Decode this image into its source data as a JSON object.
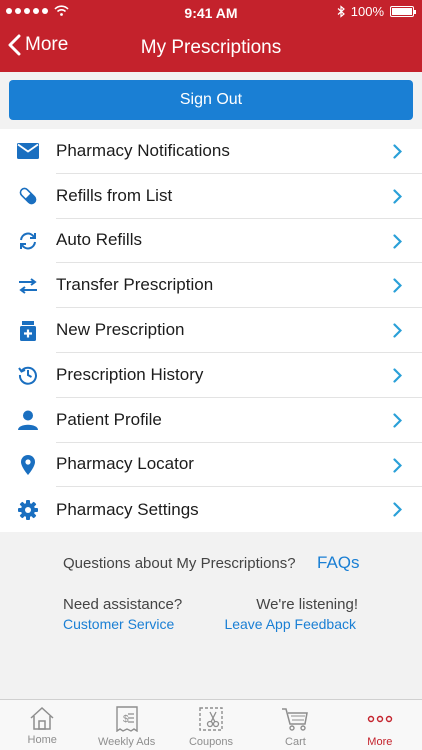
{
  "status_bar": {
    "time": "9:41 AM",
    "battery": "100%",
    "battery_level": 1.0
  },
  "nav": {
    "back_label": "More",
    "title": "My Prescriptions"
  },
  "sign_out": {
    "label": "Sign Out"
  },
  "menu": {
    "items": [
      {
        "label": "Pharmacy Notifications",
        "icon": "envelope-icon"
      },
      {
        "label": "Refills from List",
        "icon": "pill-icon"
      },
      {
        "label": "Auto Refills",
        "icon": "refresh-icon"
      },
      {
        "label": "Transfer Prescription",
        "icon": "transfer-arrows-icon"
      },
      {
        "label": "New Prescription",
        "icon": "rx-bottle-icon"
      },
      {
        "label": "Prescription History",
        "icon": "history-clock-icon"
      },
      {
        "label": "Patient Profile",
        "icon": "person-icon"
      },
      {
        "label": "Pharmacy Locator",
        "icon": "location-pin-icon"
      },
      {
        "label": "Pharmacy Settings",
        "icon": "gear-icon"
      }
    ]
  },
  "help": {
    "question": "Questions about My Prescriptions?",
    "faqs": "FAQs",
    "need_assistance": "Need assistance?",
    "customer_service": "Customer Service",
    "listening": "We're listening!",
    "feedback": "Leave App Feedback"
  },
  "tabs": [
    {
      "label": "Home",
      "icon": "home-icon",
      "active": false
    },
    {
      "label": "Weekly Ads",
      "icon": "weekly-ads-icon",
      "active": false
    },
    {
      "label": "Coupons",
      "icon": "coupon-scissors-icon",
      "active": false
    },
    {
      "label": "Cart",
      "icon": "cart-icon",
      "active": false
    },
    {
      "label": "More",
      "icon": "more-dots-icon",
      "active": true
    }
  ],
  "colors": {
    "brand_red": "#c4222c",
    "accent_blue": "#1a7fd4",
    "chevron": "#2aa0d8"
  }
}
